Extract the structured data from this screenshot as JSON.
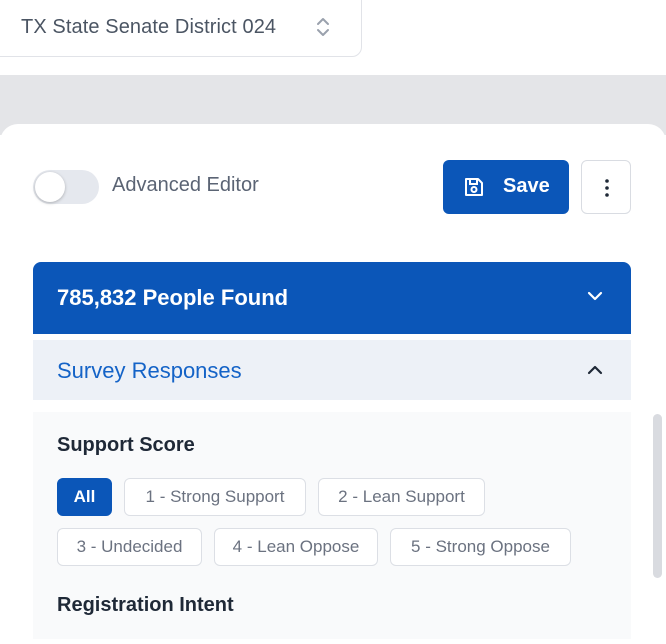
{
  "header": {
    "district_label": "TX State Senate District 024",
    "selector_icon": "chevron-up-down-icon"
  },
  "editor": {
    "toggle_label": "Advanced Editor",
    "toggle_on": false
  },
  "toolbar": {
    "save_label": "Save",
    "save_icon": "floppy-disk-icon",
    "more_icon": "vertical-dots-icon"
  },
  "results": {
    "title": "785,832 People Found",
    "expand_icon": "chevron-down-icon"
  },
  "survey": {
    "title": "Survey Responses",
    "collapse_icon": "chevron-up-icon",
    "support_score_label": "Support Score",
    "support_options": [
      "All",
      "1 - Strong Support",
      "2 - Lean Support",
      "3 - Undecided",
      "4 - Lean Oppose",
      "5 - Strong Oppose"
    ],
    "selected_option": "All",
    "registration_intent_label": "Registration Intent"
  },
  "colors": {
    "primary": "#0b56b8",
    "link": "#1463c7",
    "section_bg": "#edf1f7",
    "band": "#e4e5e8"
  }
}
